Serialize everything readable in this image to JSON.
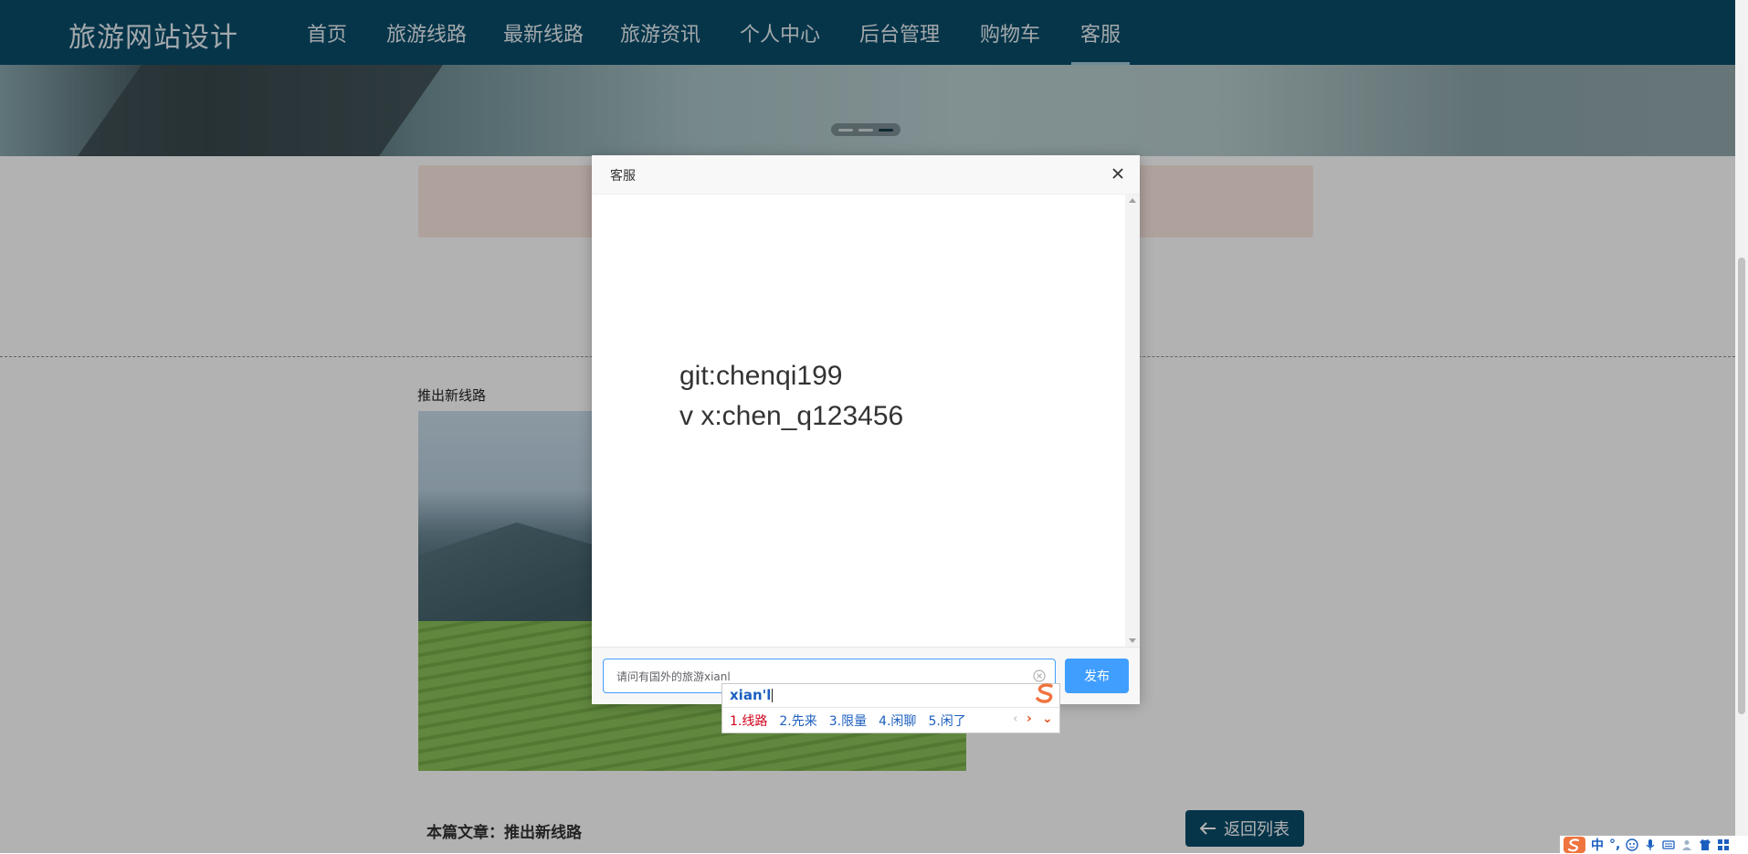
{
  "nav": {
    "brand": "旅游网站设计",
    "items": [
      {
        "label": "首页"
      },
      {
        "label": "旅游线路"
      },
      {
        "label": "最新线路"
      },
      {
        "label": "旅游资讯"
      },
      {
        "label": "个人中心"
      },
      {
        "label": "后台管理"
      },
      {
        "label": "购物车"
      },
      {
        "label": "客服"
      }
    ],
    "active_item": "客服"
  },
  "article": {
    "section_title": "推出新线路",
    "footer_label": "本篇文章：推出新线路",
    "back_button_label": "返回列表"
  },
  "dialog": {
    "title": "客服",
    "messages": [
      "git:chenqi199",
      "v x:chen_q123456"
    ],
    "input_value": "请问有国外的旅游xianl",
    "send_label": "发布"
  },
  "ime": {
    "composition": "xian'l",
    "candidates": [
      "1.线路",
      "2.先来",
      "3.限量",
      "4.闲聊",
      "5.闲了"
    ],
    "prev_label": "‹",
    "next_label": "›",
    "expand_label": "⌄"
  },
  "tray": {
    "mode_label": "中",
    "punct_label": "°,"
  },
  "colors": {
    "nav_bg": "#0a4c6a",
    "accent_blue": "#409eff",
    "ime_candidate": "#1b5fbf",
    "ime_first": "#d0021b"
  }
}
